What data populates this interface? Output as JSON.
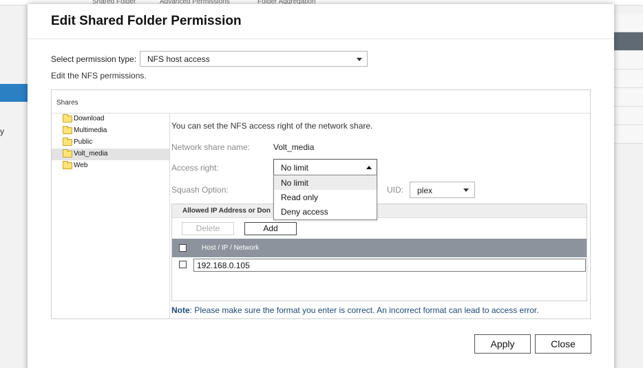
{
  "background": {
    "tabs": [
      "Shared Folder",
      "Advanced Permissions",
      "Folder Aggregation"
    ],
    "side_letter": "y"
  },
  "dialog": {
    "title": "Edit Shared Folder Permission",
    "permission_type_label": "Select permission type:",
    "permission_type_value": "NFS host access",
    "permission_desc": "Edit the NFS permissions.",
    "shares_header": "Shares",
    "folders": [
      {
        "label": "Download",
        "selected": false
      },
      {
        "label": "Multimedia",
        "selected": false
      },
      {
        "label": "Public",
        "selected": false
      },
      {
        "label": "Volt_media",
        "selected": true
      },
      {
        "label": "Web",
        "selected": false
      }
    ],
    "info_text": "You can set the NFS access right of the network share.",
    "network_share_label": "Network share name:",
    "network_share_value": "Volt_media",
    "access_right_label": "Access right:",
    "access_right_value": "No limit",
    "access_options": [
      "No limit",
      "Read only",
      "Deny access"
    ],
    "squash_label": "Squash Option:",
    "uid_label": "UID:",
    "uid_value": "plex",
    "allowed_header": "Allowed IP Address or Don",
    "delete_label": "Delete",
    "add_label": "Add",
    "grid_header": "Host / IP / Network",
    "host_entry": "192.168.0.105",
    "note_bold": "Note",
    "note_text": ": Please make sure the format you enter is correct. An incorrect format can lead to access error.",
    "apply_label": "Apply",
    "close_label": "Close"
  },
  "colors": {
    "grid_header_bg": "#8c939c",
    "note_text": "#1d4a78",
    "selected_row": "#e3e3e3",
    "folder": "#ffe37a"
  },
  "icons": {
    "folder": "folder-icon",
    "dropdown": "chevron-down-icon",
    "dropdown_open": "chevron-up-icon"
  }
}
